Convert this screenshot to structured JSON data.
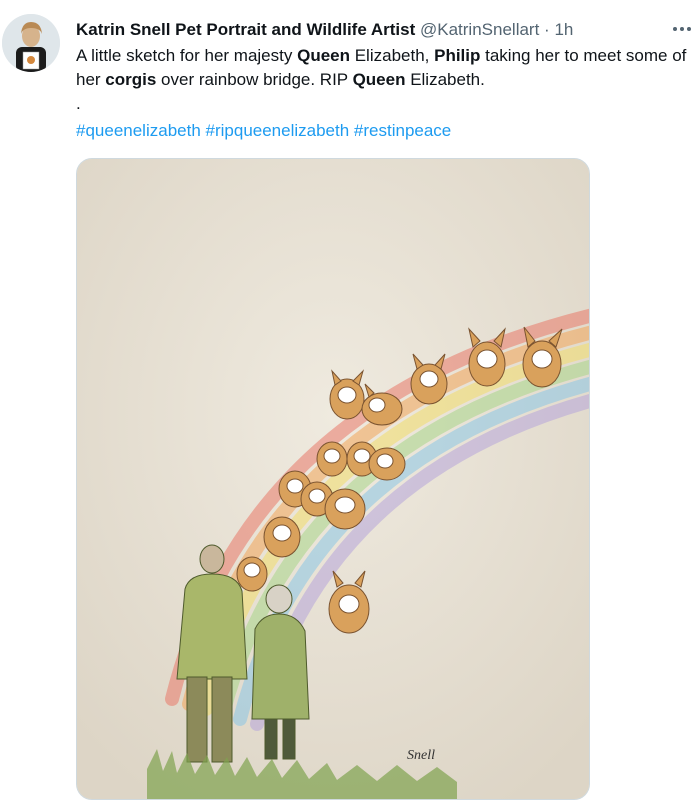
{
  "author": {
    "display_name": "Katrin Snell Pet Portrait and Wildlife Artist",
    "handle": "@KatrinSnellart",
    "separator": "·",
    "time": "1h"
  },
  "tweet": {
    "t1": "A little sketch for her majesty ",
    "b1": "Queen",
    "t2": " Elizabeth, ",
    "b2": "Philip",
    "t3": " taking her to meet some of her ",
    "b3": "corgis",
    "t4": " over rainbow bridge. RIP ",
    "b4": "Queen",
    "t5": " Elizabeth.",
    "dot": ".",
    "hashtags": [
      "#queenelizabeth",
      "#ripqueenelizabeth",
      "#restinpeace"
    ]
  },
  "icons": {
    "more": "more-horizontal-icon"
  },
  "media": {
    "subject": "Sketch of Queen Elizabeth and Philip walking toward corgis on a rainbow bridge",
    "signature": "Snell"
  },
  "colors": {
    "link": "#1d9bf0",
    "text": "#0f1419",
    "muted": "#536471",
    "paper": "#e9e3d7"
  }
}
